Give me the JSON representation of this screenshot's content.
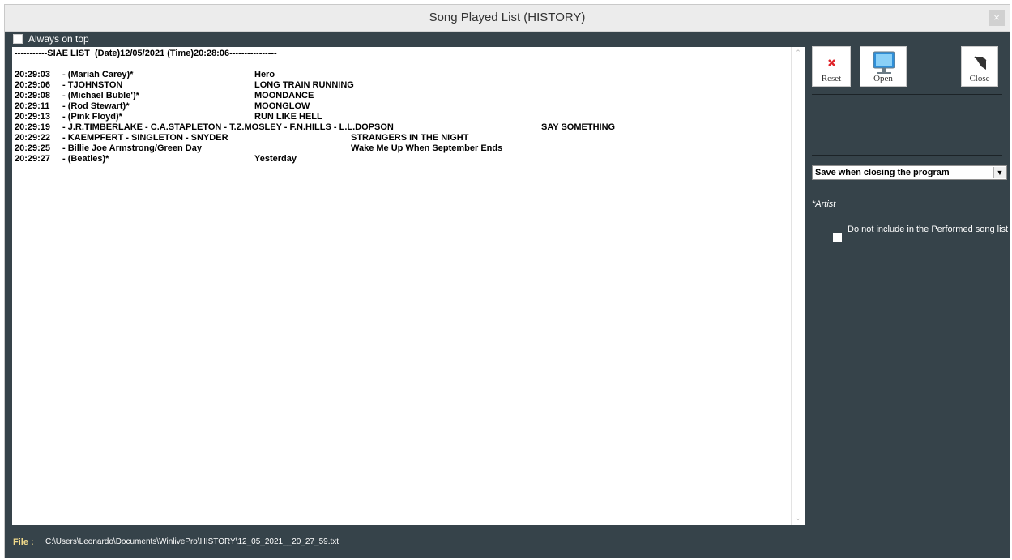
{
  "window": {
    "title": "Song Played List (HISTORY)",
    "close_glyph": "×"
  },
  "options": {
    "always_on_top_label": "Always on top",
    "always_on_top_checked": false
  },
  "list": {
    "header": "-----------SIAE LIST  (Date)12/05/2021 (Time)20:28:06----------------",
    "rows": [
      {
        "time": "20:29:03",
        "artist": "- (Mariah Carey)*",
        "title": "Hero",
        "extra": ""
      },
      {
        "time": "20:29:06",
        "artist": "- TJOHNSTON",
        "title": "LONG TRAIN RUNNING",
        "extra": ""
      },
      {
        "time": "20:29:08",
        "artist": "- (Michael Buble')*",
        "title": "MOONDANCE",
        "extra": ""
      },
      {
        "time": "20:29:11",
        "artist": "- (Rod Stewart)*",
        "title": "MOONGLOW",
        "extra": ""
      },
      {
        "time": "20:29:13",
        "artist": "- (Pink Floyd)*",
        "title": "RUN LIKE HELL",
        "extra": ""
      },
      {
        "time": "20:29:19",
        "artist": "- J.R.TIMBERLAKE - C.A.STAPLETON - T.Z.MOSLEY - F.N.HILLS - L.L.DOPSON",
        "title": "",
        "extra": "SAY SOMETHING"
      },
      {
        "time": "20:29:22",
        "artist": "- KAEMPFERT - SINGLETON - SNYDER",
        "title": "STRANGERS IN THE NIGHT",
        "extra": ""
      },
      {
        "time": "20:29:25",
        "artist": "- Billie Joe Armstrong/Green Day",
        "title": "Wake Me Up When September Ends",
        "extra": ""
      },
      {
        "time": "20:29:27",
        "artist": "- (Beatles)*",
        "title": "Yesterday",
        "extra": ""
      }
    ]
  },
  "status": {
    "file_label": "File :",
    "file_path": "C:\\Users\\Leonardo\\Documents\\WinlivePro\\HISTORY\\12_05_2021__20_27_59.txt"
  },
  "actions": {
    "reset_label": "Reset",
    "open_label": "Open",
    "close_label": "Close"
  },
  "save_mode": {
    "selected": "Save when closing the program"
  },
  "artist_note": "*Artist",
  "exclude_option": {
    "label": "Do not include in the Performed song list",
    "checked": false
  },
  "icons": {
    "reset": "x-icon",
    "open": "monitor-icon",
    "close": "exit-arrow-icon",
    "dropdown": "chevron-down-icon"
  },
  "colors": {
    "panel_bg": "#36434a",
    "reset_icon": "#e0242a",
    "open_icon": "#2f8fd8",
    "file_label": "#f0d98a"
  }
}
